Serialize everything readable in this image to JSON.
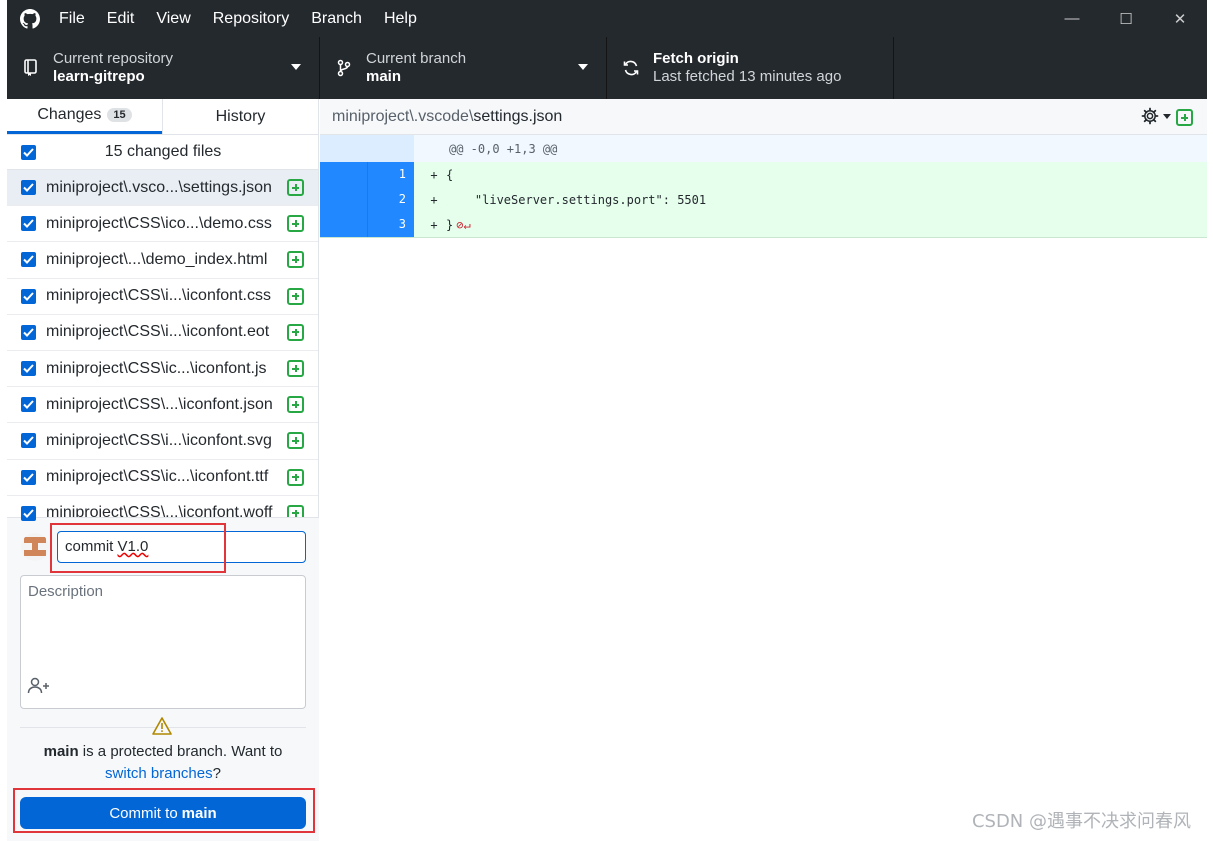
{
  "menu": [
    "File",
    "Edit",
    "View",
    "Repository",
    "Branch",
    "Help"
  ],
  "window_controls": {
    "minimize": "—",
    "maximize": "☐",
    "close": "✕"
  },
  "toolbar": {
    "repo": {
      "title": "Current repository",
      "value": "learn-gitrepo"
    },
    "branch": {
      "title": "Current branch",
      "value": "main"
    },
    "fetch": {
      "title": "Fetch origin",
      "value": "Last fetched 13 minutes ago"
    }
  },
  "tabs": {
    "changes": "Changes",
    "changes_count": "15",
    "history": "History"
  },
  "files_header": "15 changed files",
  "files": [
    "miniproject\\.vsco...\\settings.json",
    "miniproject\\CSS\\ico...\\demo.css",
    "miniproject\\...\\demo_index.html",
    "miniproject\\CSS\\i...\\iconfont.css",
    "miniproject\\CSS\\i...\\iconfont.eot",
    "miniproject\\CSS\\ic...\\iconfont.js",
    "miniproject\\CSS\\...\\iconfont.json",
    "miniproject\\CSS\\i...\\iconfont.svg",
    "miniproject\\CSS\\ic...\\iconfont.ttf",
    "miniproject\\CSS\\...\\iconfont.woff"
  ],
  "commit": {
    "summary_prefix": "commit ",
    "summary_squiggle": "V1.0",
    "description_placeholder": "Description",
    "warning_branch": "main",
    "warning_text": " is a protected branch. Want to",
    "warning_link": "switch branches",
    "warning_q": "?",
    "button_prefix": "Commit to",
    "button_branch": "main"
  },
  "diff": {
    "path_dim": "miniproject\\.vscode\\",
    "path_file": "settings.json",
    "hunk": "@@ -0,0 +1,3 @@",
    "lines": [
      {
        "num": "1",
        "sign": "+",
        "code": "{"
      },
      {
        "num": "2",
        "sign": "+",
        "code": "    \"liveServer.settings.port\": 5501"
      },
      {
        "num": "3",
        "sign": "+",
        "code": "}"
      }
    ],
    "eol_marker": "⊘↵"
  },
  "watermark": "CSDN @遇事不决求问春风",
  "colors": {
    "accent": "#0366d6",
    "toolbar_bg": "#24292e",
    "added_bg": "#e6ffed",
    "added_icon": "#28a745",
    "highlight_box": "#e0353b"
  }
}
